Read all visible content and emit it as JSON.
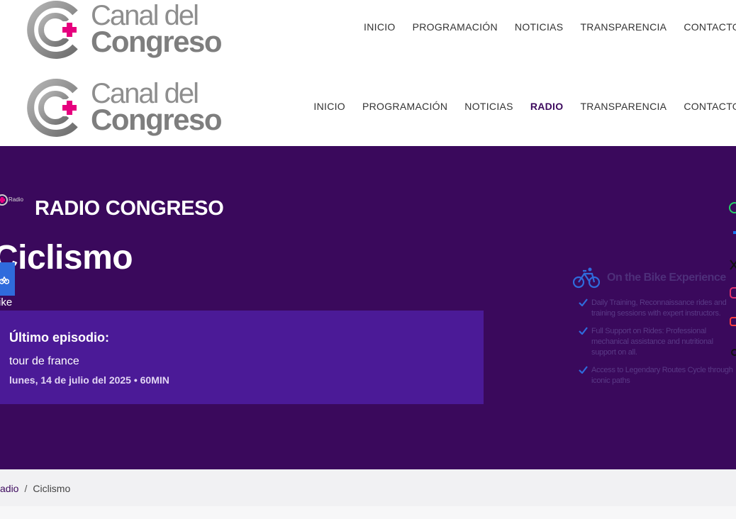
{
  "brand": {
    "logo_line1": "Canal del",
    "logo_line2": "Congreso",
    "logo_mark_color": "#e6007e",
    "logo_gray": "#8a8a8a"
  },
  "nav_primary": {
    "items": [
      {
        "label": "INICIO"
      },
      {
        "label": "PROGRAMACIÓN"
      },
      {
        "label": "NOTICIAS"
      },
      {
        "label": "TRANSPARENCIA"
      },
      {
        "label": "CONTACTO"
      }
    ]
  },
  "nav_secondary": {
    "items": [
      {
        "label": "INICIO"
      },
      {
        "label": "PROGRAMACIÓN"
      },
      {
        "label": "NOTICIAS"
      },
      {
        "label": "RADIO",
        "active": true
      },
      {
        "label": "TRANSPARENCIA"
      },
      {
        "label": "CONTACTO"
      }
    ]
  },
  "hero": {
    "background": "#3a095c",
    "station_logo_text": "Radio",
    "station_title": "RADIO CONGRESO",
    "program_title": "Ciclismo",
    "bike_label": "ike",
    "bike_badge_color": "#2f6bdc",
    "episode": {
      "heading": "Último episodio:",
      "title": "tour de france",
      "meta": "lunes, 14 de julio del 2025 • 60MIN",
      "card_color": "#4b1a97"
    },
    "promo": {
      "title": "On the Bike Experience",
      "bike_icon": "bicycle-icon",
      "items": [
        {
          "text": "Daily Training, Reconnaissance rides and training sessions with expert instructors."
        },
        {
          "text": "Full Support on Rides: Professional mechanical assistance and nutritional support on all."
        },
        {
          "text": "Access to Legendary Routes Cycle through iconic paths"
        }
      ]
    },
    "social": [
      {
        "icon": "whatsapp-icon",
        "color": "#25d366"
      },
      {
        "icon": "facebook-icon",
        "color": "#1877f2"
      },
      {
        "icon": "x-icon",
        "color": "#111111"
      },
      {
        "icon": "instagram-icon",
        "color": "#e1306c"
      },
      {
        "icon": "youtube-icon",
        "color": "#ff3d3d"
      },
      {
        "icon": "tiktok-icon",
        "color": "#111111"
      }
    ]
  },
  "breadcrumb": {
    "parent": "adio",
    "separator": "/",
    "current": "Ciclismo"
  }
}
